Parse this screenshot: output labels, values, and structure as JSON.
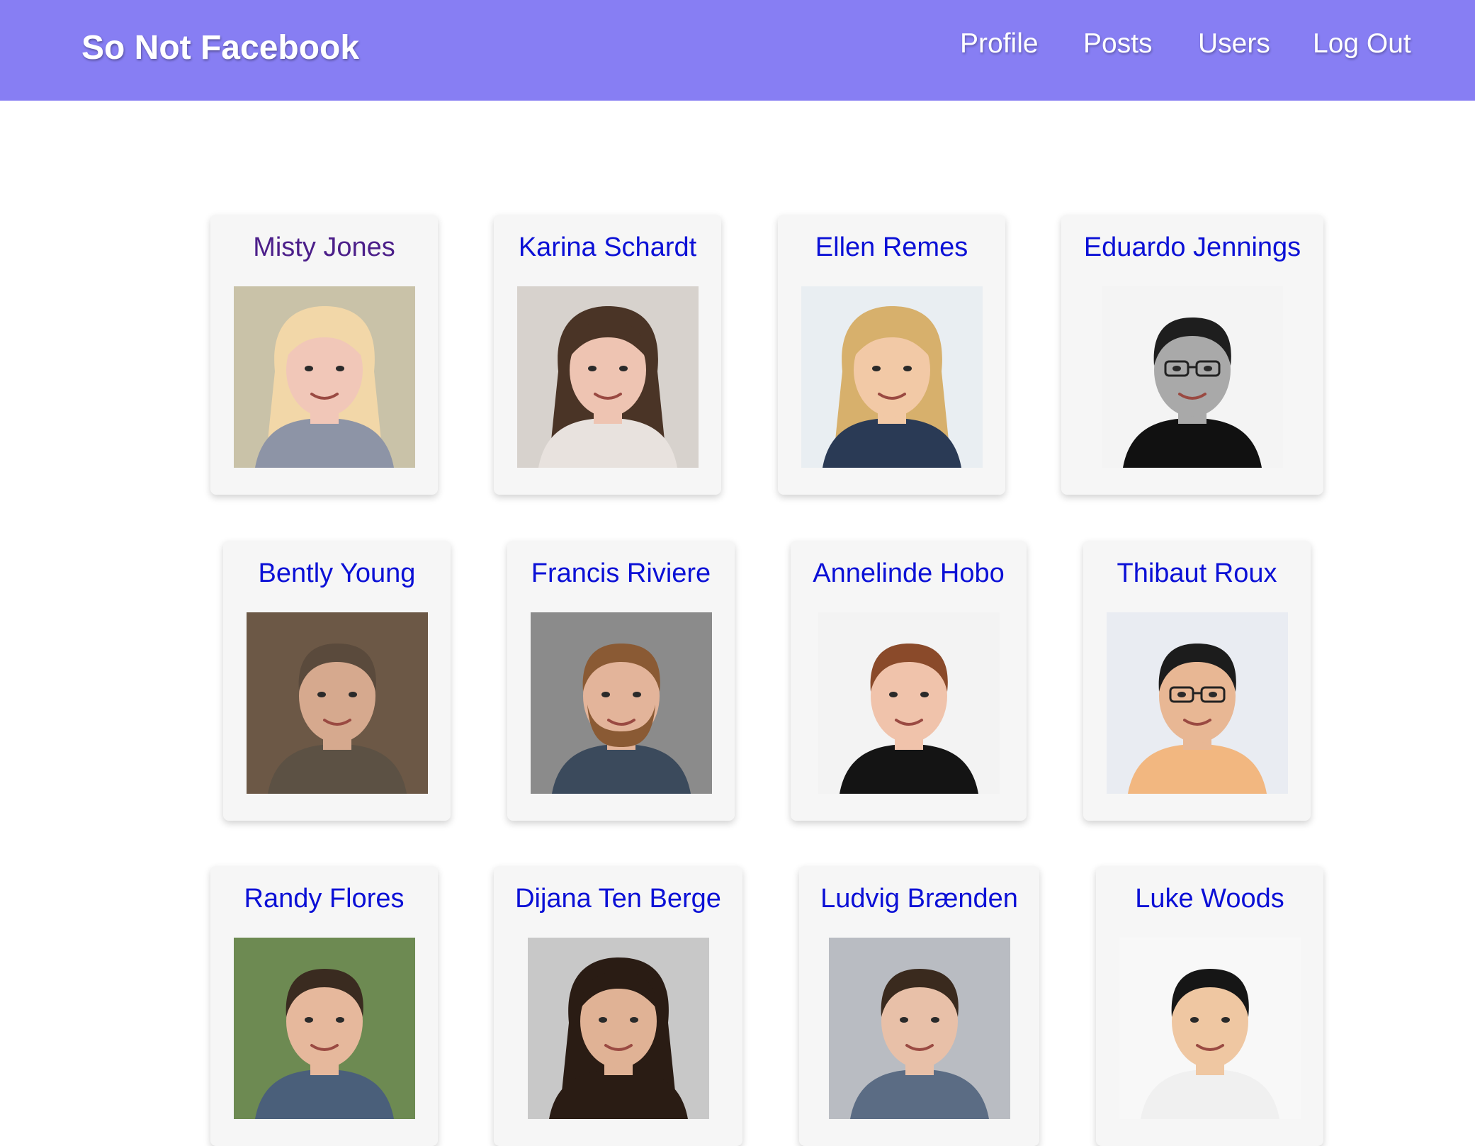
{
  "navbar": {
    "brand": "So Not Facebook",
    "links": [
      "Profile",
      "Posts",
      "Users",
      "Log Out"
    ]
  },
  "users": [
    {
      "name": "Misty Jones",
      "visited": true,
      "photo": {
        "bg": "#c9c2a8",
        "skin": "#f1c7b8",
        "hair": "#f2d7a8",
        "shirt": "#8d94a6",
        "style": "long"
      }
    },
    {
      "name": "Karina Schardt",
      "visited": false,
      "photo": {
        "bg": "#d7d2cd",
        "skin": "#eec4b2",
        "hair": "#4a3426",
        "shirt": "#e8e2de",
        "style": "long"
      }
    },
    {
      "name": "Ellen Remes",
      "visited": false,
      "photo": {
        "bg": "#e9eef2",
        "skin": "#f2c9a6",
        "hair": "#d7b06c",
        "shirt": "#2a3a55",
        "style": "long"
      }
    },
    {
      "name": "Eduardo Jennings",
      "visited": false,
      "photo": {
        "bg": "#f4f4f4",
        "skin": "#a9a9a9",
        "hair": "#1e1e1e",
        "shirt": "#111111",
        "style": "short-glasses"
      }
    },
    {
      "name": "Bently Young",
      "visited": false,
      "photo": {
        "bg": "#6c5846",
        "skin": "#d6a98e",
        "hair": "#5a4a3c",
        "shirt": "#5c5144",
        "style": "short"
      }
    },
    {
      "name": "Francis Riviere",
      "visited": false,
      "photo": {
        "bg": "#8b8b8b",
        "skin": "#e3b49a",
        "hair": "#8a5a34",
        "shirt": "#3b4a5c",
        "style": "short-beard"
      }
    },
    {
      "name": "Annelinde Hobo",
      "visited": false,
      "photo": {
        "bg": "#f3f3f3",
        "skin": "#f0c3ab",
        "hair": "#8a4a2a",
        "shirt": "#141414",
        "style": "short"
      }
    },
    {
      "name": "Thibaut Roux",
      "visited": false,
      "photo": {
        "bg": "#e9ecf2",
        "skin": "#e8b794",
        "hair": "#1c1c1c",
        "shirt": "#f2b780",
        "style": "short-glasses"
      }
    },
    {
      "name": "Randy Flores",
      "visited": false,
      "photo": {
        "bg": "#6d8a52",
        "skin": "#e6b89c",
        "hair": "#3a2b20",
        "shirt": "#4a5f7a",
        "style": "short"
      }
    },
    {
      "name": "Dijana Ten Berge",
      "visited": false,
      "photo": {
        "bg": "#c8c8c8",
        "skin": "#e0b295",
        "hair": "#2a1c14",
        "shirt": "#2a1c14",
        "style": "long"
      }
    },
    {
      "name": "Ludvig Brænden",
      "visited": false,
      "photo": {
        "bg": "#b9bcc2",
        "skin": "#e8c0a8",
        "hair": "#3a2a1e",
        "shirt": "#5b6c84",
        "style": "short"
      }
    },
    {
      "name": "Luke Woods",
      "visited": false,
      "photo": {
        "bg": "#f8f8f8",
        "skin": "#efc7a2",
        "hair": "#161616",
        "shirt": "#f0f0f0",
        "style": "short"
      }
    }
  ]
}
